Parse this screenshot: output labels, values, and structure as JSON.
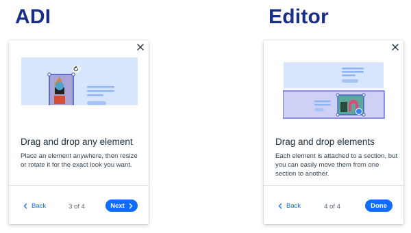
{
  "headings": {
    "left": "ADI",
    "right": "Editor"
  },
  "cards": {
    "adi": {
      "title": "Drag and drop any element",
      "description": "Place an element anywhere, then resize or rotate it for the exact look you want.",
      "back_label": "Back",
      "step": "3 of 4",
      "primary_label": "Next"
    },
    "editor": {
      "title": "Drag and drop elements",
      "description": "Each element is attached to a section, but you can easily move them from one section to another.",
      "back_label": "Back",
      "step": "4 of 4",
      "primary_label": "Done"
    }
  },
  "colors": {
    "heading": "#1b2e86",
    "accent": "#116dff",
    "illustration_bg": "#d7e6fd",
    "illustration_line": "#8fb4f4",
    "selection": "#3b52c4"
  }
}
